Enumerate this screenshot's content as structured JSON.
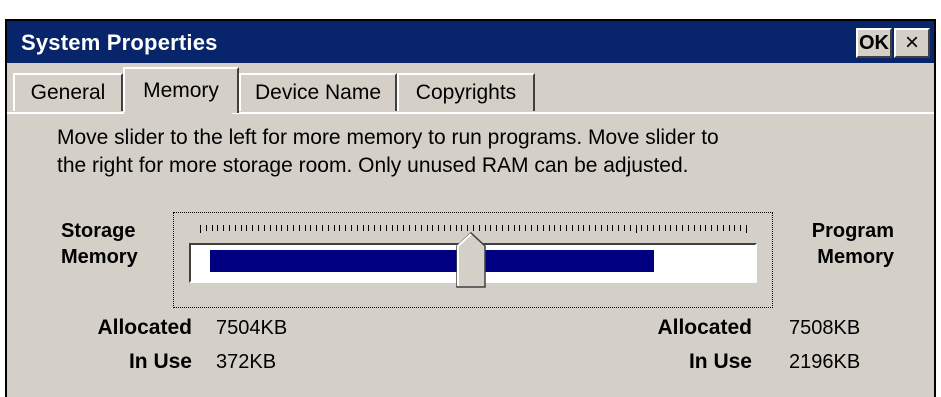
{
  "window": {
    "title": "System Properties",
    "ok_label": "OK",
    "close_label": "×"
  },
  "tabs": [
    {
      "label": "General",
      "selected": false
    },
    {
      "label": "Memory",
      "selected": true
    },
    {
      "label": "Device Name",
      "selected": false
    },
    {
      "label": "Copyrights",
      "selected": false
    }
  ],
  "memory": {
    "description_line1": "Move slider to the left for more memory to run programs. Move slider to",
    "description_line2": "the right for more storage room. Only unused RAM can be adjusted.",
    "storage_label_1": "Storage",
    "storage_label_2": "Memory",
    "program_label_1": "Program",
    "program_label_2": "Memory",
    "slider": {
      "fill_fraction": 0.79,
      "thumb_fraction": 0.5,
      "fill_color": "#000080"
    },
    "storage": {
      "allocated_label": "Allocated",
      "allocated_value": "7504KB",
      "in_use_label": "In Use",
      "in_use_value": "372KB"
    },
    "program": {
      "allocated_label": "Allocated",
      "allocated_value": "7508KB",
      "in_use_label": "In Use",
      "in_use_value": "2196KB"
    }
  }
}
